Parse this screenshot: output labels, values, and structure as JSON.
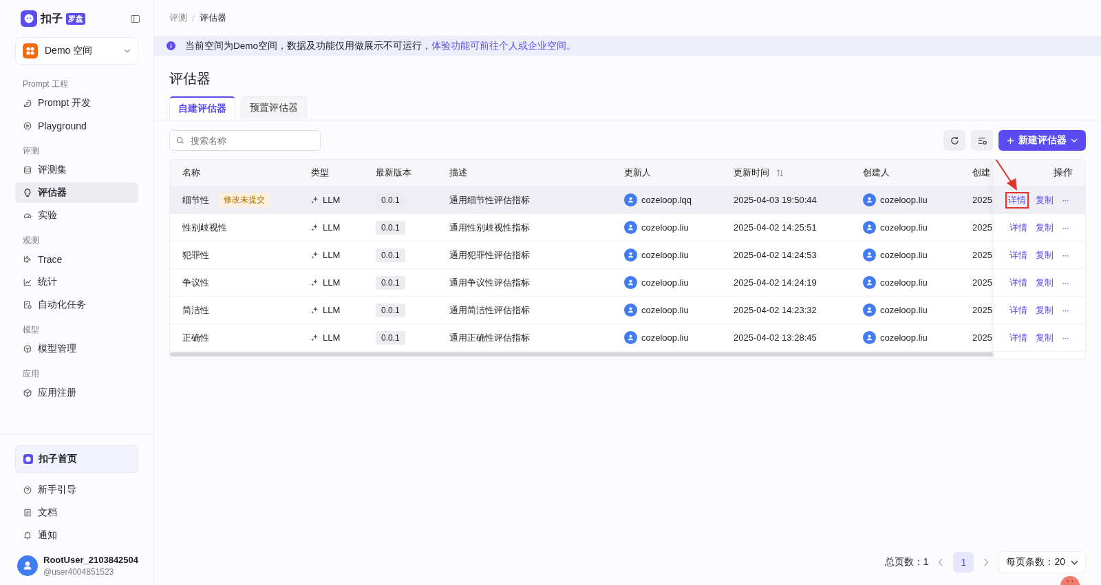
{
  "sidebar": {
    "logo": {
      "text": "扣子",
      "badge": "罗盘"
    },
    "workspace": {
      "name": "Demo 空间"
    },
    "sections": [
      {
        "title": "Prompt 工程",
        "items": [
          {
            "label": "Prompt 开发",
            "selected": false
          },
          {
            "label": "Playground",
            "selected": false
          }
        ]
      },
      {
        "title": "评测",
        "items": [
          {
            "label": "评测集",
            "selected": false
          },
          {
            "label": "评估器",
            "selected": true
          },
          {
            "label": "实验",
            "selected": false
          }
        ]
      },
      {
        "title": "观测",
        "items": [
          {
            "label": "Trace",
            "selected": false
          },
          {
            "label": "统计",
            "selected": false
          },
          {
            "label": "自动化任务",
            "selected": false
          }
        ]
      },
      {
        "title": "模型",
        "items": [
          {
            "label": "模型管理",
            "selected": false
          }
        ]
      },
      {
        "title": "应用",
        "items": [
          {
            "label": "应用注册",
            "selected": false
          }
        ]
      }
    ],
    "home": {
      "label": "扣子首页"
    },
    "links": [
      {
        "label": "新手引导"
      },
      {
        "label": "文档"
      },
      {
        "label": "通知"
      }
    ],
    "user": {
      "name": "RootUser_2103842504",
      "handle": "@user4004851523"
    }
  },
  "breadcrumb": [
    {
      "label": "评测",
      "current": false
    },
    {
      "label": "评估器",
      "current": true
    }
  ],
  "breadcrumb_separator": "/",
  "notice": {
    "text": "当前空间为Demo空间，数据及功能仅用做展示不可运行，",
    "link": "体验功能可前往个人或企业空间。"
  },
  "title": "评估器",
  "tabs": [
    {
      "label": "自建评估器",
      "selected": true
    },
    {
      "label": "预置评估器",
      "selected": false
    }
  ],
  "search": {
    "placeholder": "搜索名称"
  },
  "new_button": "新建评估器",
  "table": {
    "columns": [
      {
        "label": "名称",
        "sortable": false
      },
      {
        "label": "类型",
        "sortable": false
      },
      {
        "label": "最新版本",
        "sortable": false
      },
      {
        "label": "描述",
        "sortable": false
      },
      {
        "label": "更新人",
        "sortable": false
      },
      {
        "label": "更新时间",
        "sortable": true
      },
      {
        "label": "创建人",
        "sortable": false
      },
      {
        "label": "创建",
        "sortable": false
      }
    ],
    "actions_column": "操作",
    "rows": [
      {
        "name": "细节性",
        "badge": "修改未提交",
        "type": "LLM",
        "version": "0.0.1",
        "description": "通用细节性评估指标",
        "updater": "cozeloop.lqq",
        "updated_at": "2025-04-03 19:50:44",
        "creator": "cozeloop.liu",
        "created_at": "2025",
        "hovered": true,
        "actions": {
          "detail": "详情",
          "copy": "复制",
          "more": "···",
          "highlighted": true
        }
      },
      {
        "name": "性别歧视性",
        "type": "LLM",
        "version": "0.0.1",
        "description": "通用性别歧视性指标",
        "updater": "cozeloop.liu",
        "updated_at": "2025-04-02 14:25:51",
        "creator": "cozeloop.liu",
        "created_at": "2025",
        "hovered": false,
        "actions": {
          "detail": "详情",
          "copy": "复制",
          "more": "···",
          "highlighted": false
        }
      },
      {
        "name": "犯罪性",
        "type": "LLM",
        "version": "0.0.1",
        "description": "通用犯罪性评估指标",
        "updater": "cozeloop.liu",
        "updated_at": "2025-04-02 14:24:53",
        "creator": "cozeloop.liu",
        "created_at": "2025",
        "hovered": false,
        "actions": {
          "detail": "详情",
          "copy": "复制",
          "more": "···",
          "highlighted": false
        }
      },
      {
        "name": "争议性",
        "type": "LLM",
        "version": "0.0.1",
        "description": "通用争议性评估指标",
        "updater": "cozeloop.liu",
        "updated_at": "2025-04-02 14:24:19",
        "creator": "cozeloop.liu",
        "created_at": "2025",
        "hovered": false,
        "actions": {
          "detail": "详情",
          "copy": "复制",
          "more": "···",
          "highlighted": false
        }
      },
      {
        "name": "简洁性",
        "type": "LLM",
        "version": "0.0.1",
        "description": "通用简洁性评估指标",
        "updater": "cozeloop.liu",
        "updated_at": "2025-04-02 14:23:32",
        "creator": "cozeloop.liu",
        "created_at": "2025",
        "hovered": false,
        "actions": {
          "detail": "详情",
          "copy": "复制",
          "more": "···",
          "highlighted": false
        }
      },
      {
        "name": "正确性",
        "type": "LLM",
        "version": "0.0.1",
        "description": "通用正确性评估指标",
        "updater": "cozeloop.liu",
        "updated_at": "2025-04-02 13:28:45",
        "creator": "cozeloop.liu",
        "created_at": "2025",
        "hovered": false,
        "actions": {
          "detail": "详情",
          "copy": "复制",
          "more": "···",
          "highlighted": false
        }
      }
    ]
  },
  "pagination": {
    "total": "总页数：1",
    "pages": [
      {
        "label": "1",
        "selected": true
      }
    ],
    "page_size": "每页条数：20"
  }
}
